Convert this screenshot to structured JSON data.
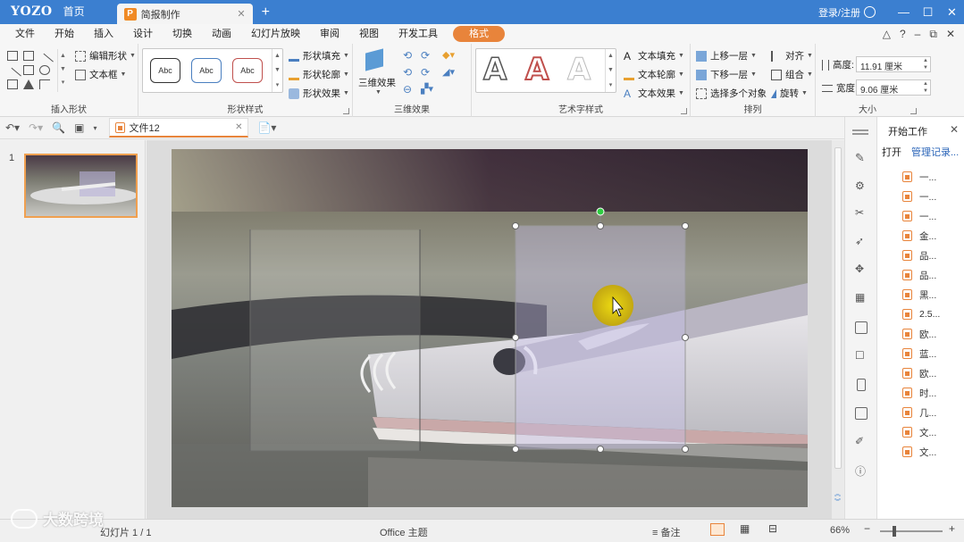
{
  "app": {
    "logo": "YOZO",
    "home_tab": "首页",
    "doc_tab": "简报制作",
    "login": "登录/注册"
  },
  "menu": {
    "items": [
      "文件",
      "开始",
      "插入",
      "设计",
      "切换",
      "动画",
      "幻灯片放映",
      "审阅",
      "视图",
      "开发工具"
    ],
    "active": "格式"
  },
  "ribbon": {
    "insert_shape": {
      "edit_shape": "编辑形状",
      "textbox": "文本框",
      "label": "插入形状"
    },
    "shape_style": {
      "abc": "Abc",
      "fill": "形状填充",
      "outline": "形状轮廓",
      "effect": "形状效果",
      "label": "形状样式"
    },
    "three_d": {
      "button": "三维效果",
      "label": "三维效果"
    },
    "wordart": {
      "letter": "A",
      "text_fill": "文本填充",
      "text_outline": "文本轮廓",
      "text_effect": "文本效果",
      "label": "艺术字样式"
    },
    "arrange": {
      "bring_forward": "上移一层",
      "send_backward": "下移一层",
      "select_multi": "选择多个对象",
      "align": "对齐",
      "group": "组合",
      "rotate": "旋转",
      "label": "排列"
    },
    "size": {
      "height_label": "高度:",
      "height_value": "11.91 厘米",
      "width_label": "宽度:",
      "width_value": "9.06 厘米",
      "label": "大小"
    }
  },
  "quickbar": {
    "file_tab": "文件12"
  },
  "thumbnails": {
    "slide_number": "1"
  },
  "taskpane": {
    "title": "开始工作",
    "open": "打开",
    "manage": "管理记录...",
    "items": [
      "一...",
      "一...",
      "一...",
      "金...",
      "品...",
      "品...",
      "黑...",
      "2.5...",
      "欧...",
      "蓝...",
      "欧...",
      "时...",
      "几...",
      "文...",
      "文..."
    ]
  },
  "statusbar": {
    "slide_counter": "幻灯片 1 / 1",
    "theme": "Office 主题",
    "notes": "备注",
    "zoom": "66%"
  },
  "watermark": "大数跨境",
  "colors": {
    "titlebar": "#3b7fd0",
    "accent": "#e8843b"
  }
}
